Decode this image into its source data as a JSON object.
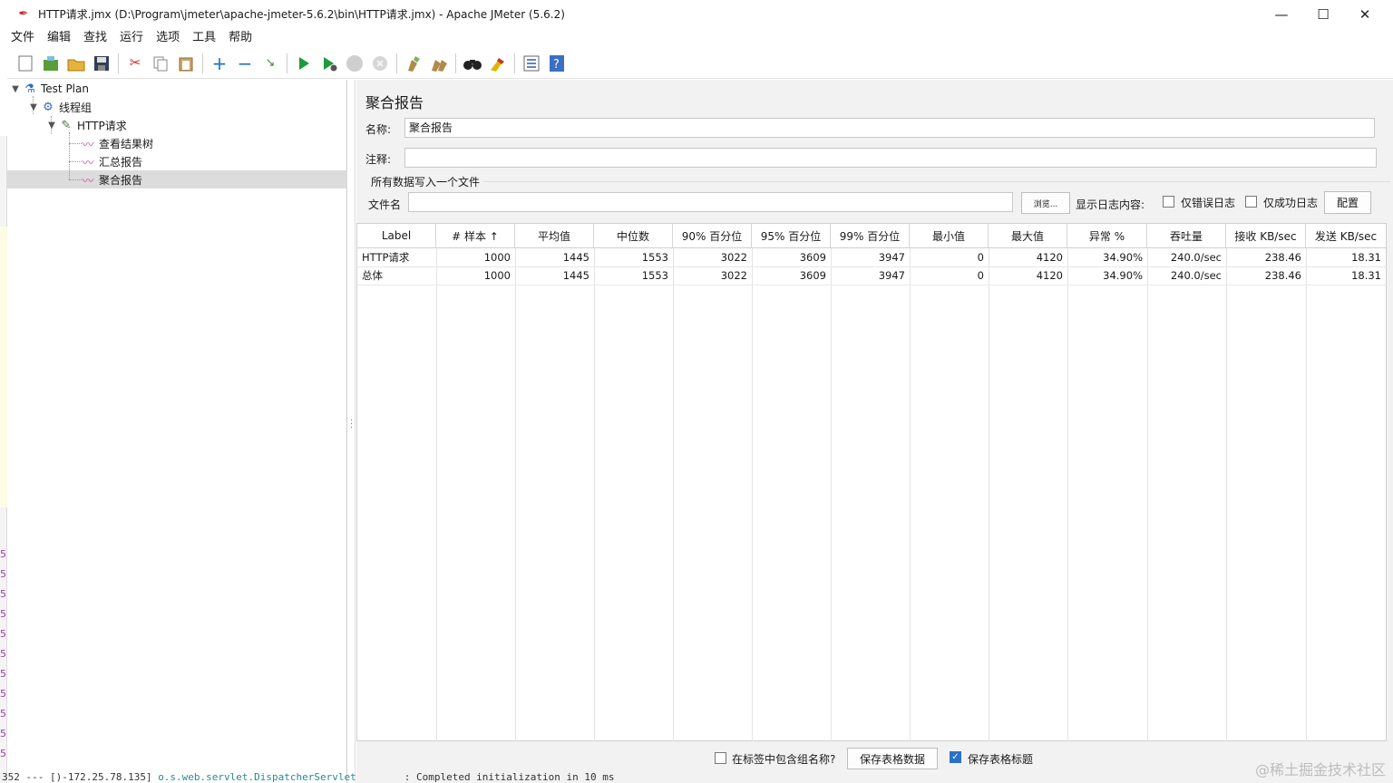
{
  "window": {
    "title": "HTTP请求.jmx (D:\\Program\\jmeter\\apache-jmeter-5.6.2\\bin\\HTTP请求.jmx) - Apache JMeter (5.6.2)",
    "minimize": "—",
    "maximize": "☐",
    "close": "✕"
  },
  "menu": [
    "文件",
    "编辑",
    "查找",
    "运行",
    "选项",
    "工具",
    "帮助"
  ],
  "toolbar_icons": [
    "new-icon",
    "templates-icon",
    "open-icon",
    "save-icon",
    "cut-icon",
    "copy-icon",
    "paste-icon",
    "expand-icon",
    "collapse-icon",
    "toggle-icon",
    "start-icon",
    "start-no-pause-icon",
    "stop-icon",
    "shutdown-icon",
    "clear-icon",
    "clear-all-icon",
    "search-icon",
    "reset-search-icon",
    "function-helper-icon",
    "help-icon"
  ],
  "tree": {
    "items": [
      {
        "label": "Test Plan",
        "icon": "test-plan-icon"
      },
      {
        "label": "线程组",
        "icon": "gear-icon"
      },
      {
        "label": "HTTP请求",
        "icon": "pipette-icon"
      },
      {
        "label": "查看结果树",
        "icon": "chart-icon"
      },
      {
        "label": "汇总报告",
        "icon": "chart-icon"
      },
      {
        "label": "聚合报告",
        "icon": "chart-icon"
      }
    ],
    "selected": "聚合报告"
  },
  "panel": {
    "title": "聚合报告",
    "name_label": "名称:",
    "name_value": "聚合报告",
    "comment_label": "注释:",
    "comment_value": "",
    "group_title": "所有数据写入一个文件",
    "filename_label": "文件名",
    "filename_value": "",
    "browse_button": "浏览...",
    "log_content_label": "显示日志内容:",
    "errors_only": "仅错误日志",
    "success_only": "仅成功日志",
    "configure_button": "配置"
  },
  "table": {
    "headers": [
      "Label",
      "# 样本 ↑",
      "平均值",
      "中位数",
      "90% 百分位",
      "95% 百分位",
      "99% 百分位",
      "最小值",
      "最大值",
      "异常 %",
      "吞吐量",
      "接收 KB/sec",
      "发送 KB/sec"
    ],
    "rows": [
      [
        "HTTP请求",
        "1000",
        "1445",
        "1553",
        "3022",
        "3609",
        "3947",
        "0",
        "4120",
        "34.90%",
        "240.0/sec",
        "238.46",
        "18.31"
      ],
      [
        "总体",
        "1000",
        "1445",
        "1553",
        "3022",
        "3609",
        "3947",
        "0",
        "4120",
        "34.90%",
        "240.0/sec",
        "238.46",
        "18.31"
      ]
    ]
  },
  "bottom": {
    "include_group_label": "在标签中包含组名称?",
    "include_group_checked": false,
    "save_table_button": "保存表格数据",
    "save_header_label": "保存表格标题",
    "save_header_checked": true
  },
  "console": {
    "prefix": "352 --- [)-172.25.78.135] ",
    "link": "o.s.web.servlet.DispatcherServlet",
    "suffix": "        : Completed initialization in 10 ms"
  },
  "watermark": "@稀土掘金技术社区",
  "colors": {
    "selection": "#dcdcdc",
    "panel_bg": "#f2f2f2",
    "checkbox_accent": "#2a72c9"
  }
}
